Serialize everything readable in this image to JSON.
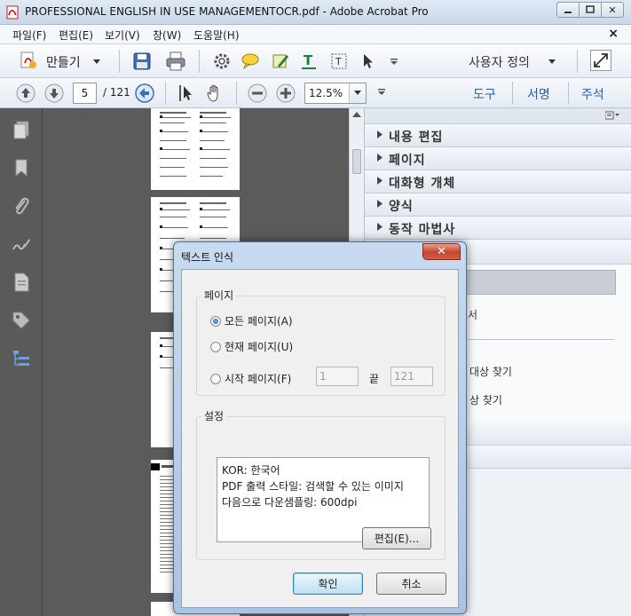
{
  "window": {
    "title": "PROFESSIONAL ENGLISH IN USE MANAGEMENTOCR.pdf - Adobe Acrobat Pro",
    "close_glyph": "✕"
  },
  "menubar": {
    "items": [
      "파일(F)",
      "편집(E)",
      "보기(V)",
      "창(W)",
      "도움말(H)"
    ],
    "close_glyph": "×"
  },
  "toolbar": {
    "create_label": "만들기",
    "customize_label": "사용자 정의"
  },
  "navbar": {
    "current_page": "5",
    "total_pages": "/ 121",
    "zoom": "12.5%",
    "links": [
      "도구",
      "서명",
      "주석"
    ]
  },
  "task_pane": {
    "sections": [
      "내용 편집",
      "페이지",
      "대화형 개체",
      "양식",
      "동작 마법사"
    ],
    "partial_texts": [
      "서",
      "대상 찾기",
      "상 찾기"
    ]
  },
  "dialog": {
    "title": "텍스트 인식",
    "page_group_label": "페이지",
    "radio_all": "모든 페이지(A)",
    "radio_current": "현재 페이지(U)",
    "radio_from": "시작 페이지(F)",
    "from_value": "1",
    "to_label": "끝",
    "to_value": "121",
    "settings_group_label": "설정",
    "settings_lines": [
      "KOR: 한국어",
      "PDF 출력 스타일: 검색할 수 있는 이미지",
      "다음으로 다운샘플링: 600dpi"
    ],
    "edit_button": "편집(E)...",
    "ok_button": "확인",
    "cancel_button": "취소"
  },
  "colors": {
    "link_blue": "#2a5ea8",
    "doc_background": "#5b5b5b",
    "dialog_frame": "#a9c3e2"
  }
}
